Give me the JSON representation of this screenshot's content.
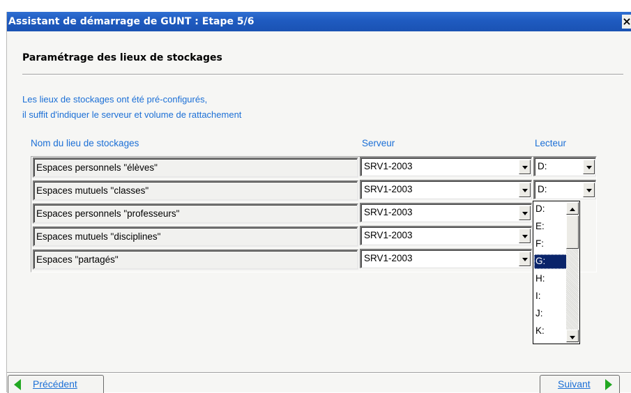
{
  "window": {
    "title": "Assistant de démarrage de GUNT : Etape 5/6",
    "close_label": "×"
  },
  "section_title": "Paramétrage des lieux de stockages",
  "description": [
    "Les lieux de stockages ont été pré-configurés,",
    "il suffit d'indiquer le serveur et volume de rattachement"
  ],
  "columns": {
    "name": "Nom du lieu  de stockages",
    "server": "Serveur",
    "drive": "Lecteur"
  },
  "rows": [
    {
      "name": "Espaces personnels \"élèves\"",
      "server": "SRV1-2003",
      "drive": "D:"
    },
    {
      "name": "Espaces mutuels \"classes\"",
      "server": "SRV1-2003",
      "drive": "D:"
    },
    {
      "name": "Espaces personnels \"professeurs\"",
      "server": "SRV1-2003",
      "drive": ""
    },
    {
      "name": "Espaces mutuels \"disciplines\"",
      "server": "SRV1-2003",
      "drive": ""
    },
    {
      "name": "Espaces \"partagés\"",
      "server": "SRV1-2003",
      "drive": ""
    }
  ],
  "drive_dropdown": {
    "options": [
      "D:",
      "E:",
      "F:",
      "G:",
      "H:",
      "I:",
      "J:",
      "K:"
    ],
    "selected": "G:"
  },
  "nav": {
    "prev_label": "Précédent",
    "next_label": "Suivant"
  },
  "colors": {
    "title_bar": "#1f5bc0",
    "accent_text": "#1b6fd6",
    "selection": "#0a246a",
    "nav_arrow": "#22a822"
  },
  "icons": {
    "prev": "green-left-arrow-icon",
    "next": "green-right-arrow-icon",
    "dropdown": "chevron-down-icon"
  }
}
